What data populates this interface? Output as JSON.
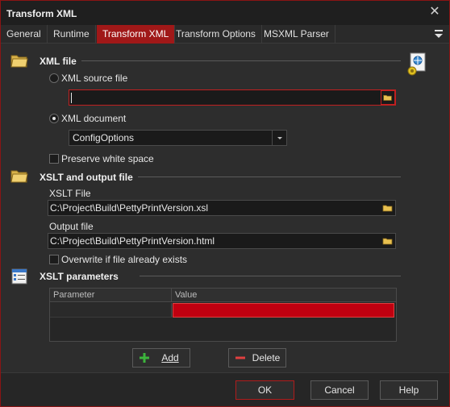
{
  "window": {
    "title": "Transform XML",
    "close_glyph": "✕"
  },
  "tabs": [
    {
      "label": "General"
    },
    {
      "label": "Runtime"
    },
    {
      "label": "Transform XML",
      "active": true
    },
    {
      "label": "Transform Options"
    },
    {
      "label": "MSXML Parser"
    }
  ],
  "xml_file": {
    "heading": "XML file",
    "source_option_label": "XML source file",
    "source_path_value": "",
    "document_option_label": "XML document",
    "document_selected": "ConfigOptions",
    "preserve_whitespace_label": "Preserve white space",
    "selected_option": "XML document"
  },
  "xslt_output": {
    "heading": "XSLT and output file",
    "xslt_file_label": "XSLT File",
    "xslt_file_value": "C:\\Project\\Build\\PettyPrintVersion.xsl",
    "output_file_label": "Output file",
    "output_file_value": "C:\\Project\\Build\\PettyPrintVersion.html",
    "overwrite_label": "Overwrite if file already exists"
  },
  "xslt_params": {
    "heading": "XSLT parameters",
    "columns": [
      "Parameter",
      "Value"
    ],
    "rows": [
      {
        "parameter": "",
        "value": ""
      }
    ],
    "add_label": "Add",
    "delete_label": "Delete"
  },
  "footer": {
    "ok_label": "OK",
    "cancel_label": "Cancel",
    "help_label": "Help"
  },
  "colors": {
    "accent": "#a01818",
    "selected_cell": "#c00010",
    "background": "#2d2d2d",
    "add_icon": "#3cb43c",
    "delete_icon": "#e04040"
  }
}
